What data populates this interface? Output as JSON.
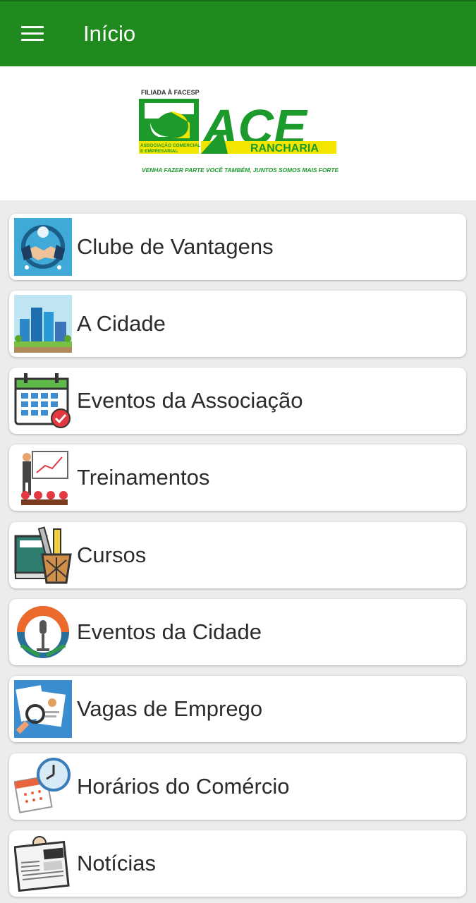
{
  "appbar": {
    "title": "Início",
    "menu_icon": "hamburger-menu-icon"
  },
  "logo": {
    "top_text": "FILIADA À FACESP",
    "name": "ACE",
    "left_text_line1": "ASSOCIAÇÃO COMERCIAL",
    "left_text_line2": "E EMPRESARIAL",
    "city": "RANCHARIA",
    "slogan": "VENHA FAZER PARTE VOCÊ TAMBÉM, JUNTOS SOMOS MAIS FORTES!",
    "colors": {
      "green": "#1c9a2c",
      "yellow": "#f2e600"
    }
  },
  "menu": {
    "items": [
      {
        "label": "Clube de Vantagens",
        "icon": "handshake-icon"
      },
      {
        "label": "A Cidade",
        "icon": "city-buildings-icon"
      },
      {
        "label": "Eventos da Associação",
        "icon": "calendar-check-icon"
      },
      {
        "label": "Treinamentos",
        "icon": "presentation-training-icon"
      },
      {
        "label": "Cursos",
        "icon": "books-pencil-cup-icon"
      },
      {
        "label": "Eventos da Cidade",
        "icon": "microphone-event-icon"
      },
      {
        "label": "Vagas de Emprego",
        "icon": "resume-magnifier-icon"
      },
      {
        "label": "Horários do Comércio",
        "icon": "clock-calendar-icon"
      },
      {
        "label": "Notícias",
        "icon": "newspaper-icon"
      }
    ]
  }
}
